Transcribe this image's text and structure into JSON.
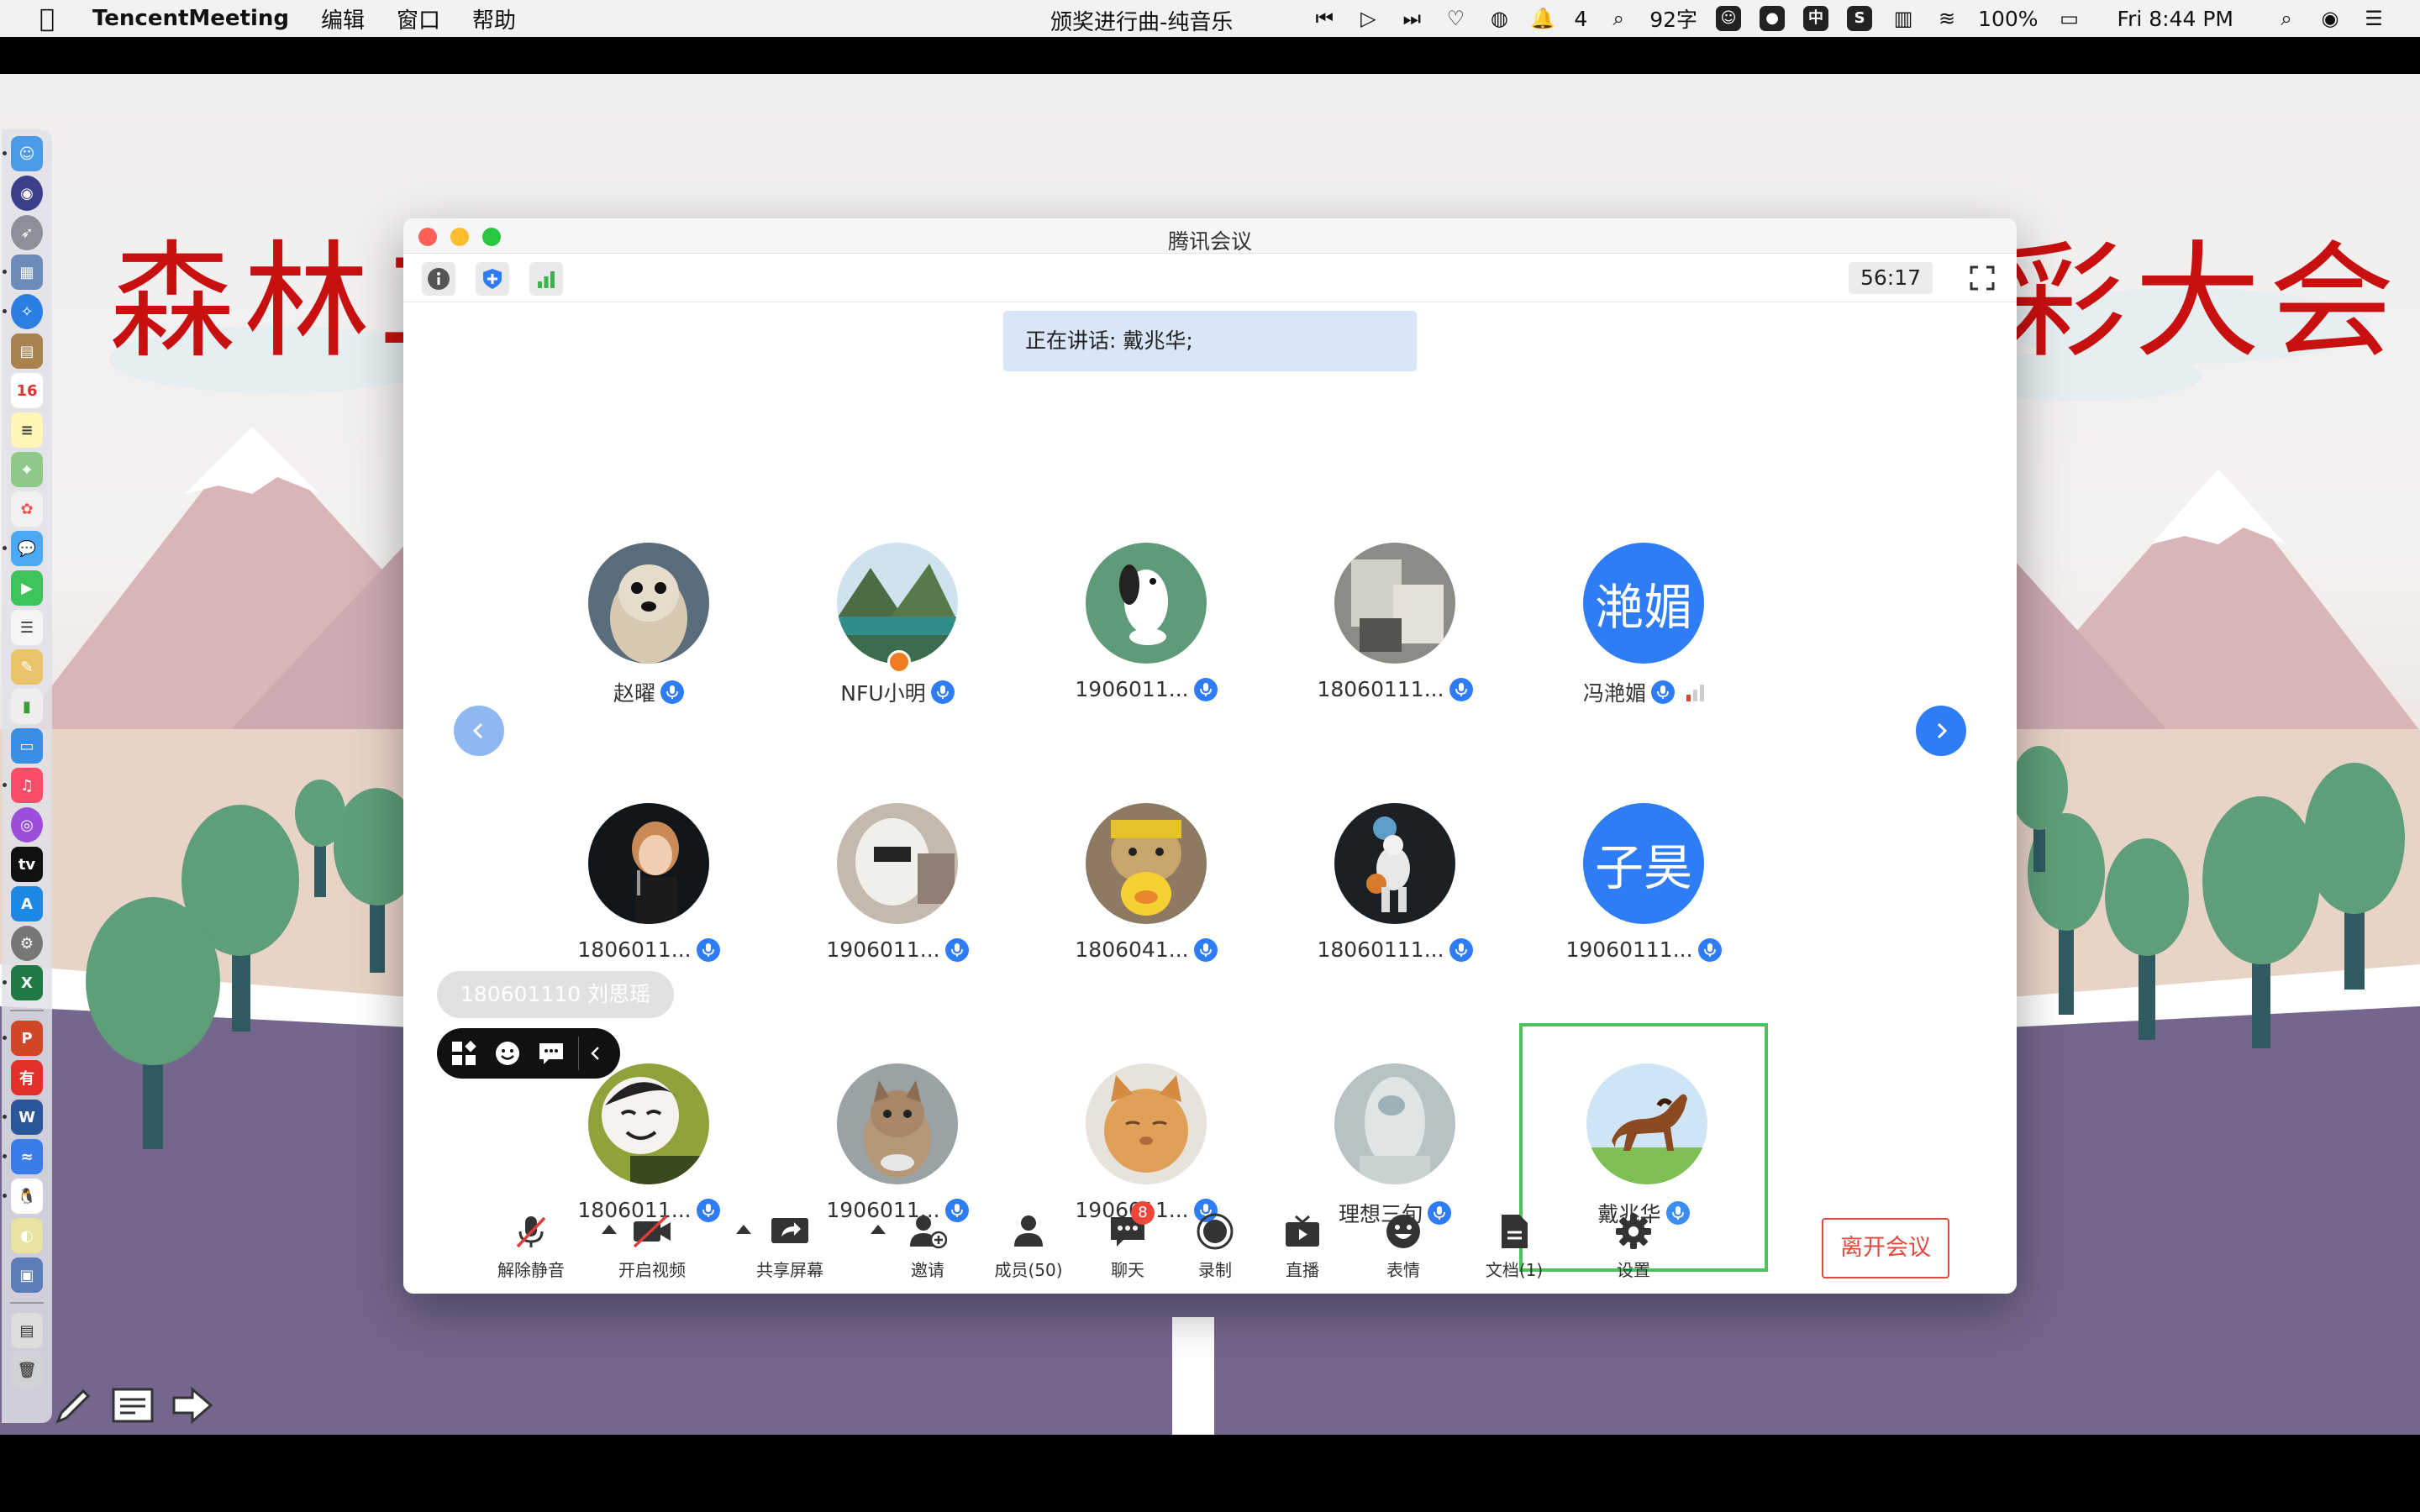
{
  "menubar": {
    "app_name": "TencentMeeting",
    "menus": [
      "编辑",
      "窗口",
      "帮助"
    ],
    "now_playing": "颁奖进行曲-纯音乐",
    "notifications_count": "4",
    "char_count": "92字",
    "ime": "中",
    "battery": "100%",
    "clock": "Fri 8:44 PM"
  },
  "slide": {
    "title_left": "森林二",
    "title_right": "彩大会"
  },
  "window": {
    "title": "腾讯会议",
    "timer": "56:17",
    "speaking": "正在讲话: 戴兆华;"
  },
  "participants": [
    {
      "name": "赵曜",
      "avatar": "dog-photo"
    },
    {
      "name": "NFU小明",
      "avatar": "mountain-lake-photo",
      "host": true
    },
    {
      "name": "1906011...",
      "avatar": "snoopy-photo"
    },
    {
      "name": "18060111...",
      "avatar": "room-photo"
    },
    {
      "name": "冯滟媚",
      "avatar_text": "滟媚",
      "signal": "weak"
    },
    {
      "name": "1806011...",
      "avatar": "singer-photo"
    },
    {
      "name": "1906011...",
      "avatar": "hooded-photo"
    },
    {
      "name": "1806041...",
      "avatar": "cat-duck-photo"
    },
    {
      "name": "18060111...",
      "avatar": "astronaut-photo"
    },
    {
      "name": "19060111...",
      "avatar_text": "子昊"
    },
    {
      "name": "1806011...",
      "avatar": "cartoon-face-photo"
    },
    {
      "name": "1906011...",
      "avatar": "kitten-photo"
    },
    {
      "name": "1906011...",
      "avatar": "orange-cat-photo"
    },
    {
      "name": "理想三旬",
      "avatar": "sculpture-photo"
    },
    {
      "name": "戴兆华",
      "avatar": "horse-photo",
      "speaking": true
    }
  ],
  "floating": {
    "name": "180601110 刘思瑶"
  },
  "toolbar": {
    "unmute": "解除静音",
    "start_video": "开启视频",
    "share_screen": "共享屏幕",
    "invite": "邀请",
    "members": "成员(50)",
    "chat": "聊天",
    "chat_badge": "8",
    "record": "录制",
    "live": "直播",
    "reactions": "表情",
    "docs": "文档(1)",
    "settings": "设置",
    "leave": "离开会议"
  },
  "colors": {
    "accent_blue": "#2e7cf6",
    "speaking_green": "#4cc25d",
    "leave_red": "#e04a3f",
    "slide_title_red": "#c81010"
  }
}
